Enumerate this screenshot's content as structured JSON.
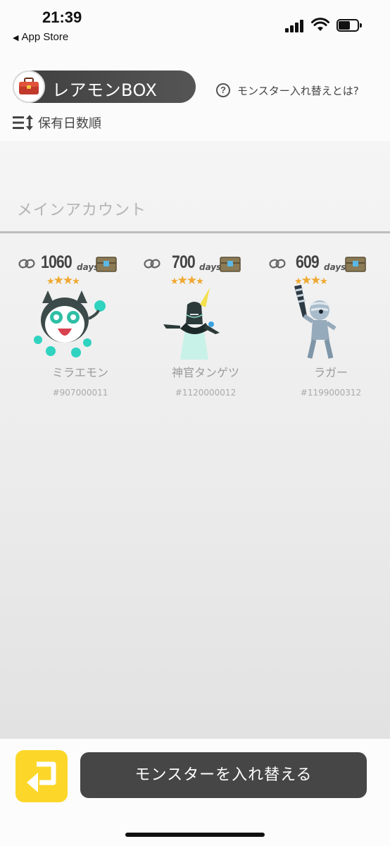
{
  "status_bar": {
    "time": "21:39",
    "back_label": "App Store"
  },
  "header": {
    "title": "レアモンBOX",
    "help_label": "モンスター入れ替えとは?",
    "sort_label": "保有日数順"
  },
  "section": {
    "title": "メインアカウント"
  },
  "monsters": [
    {
      "days": "1060",
      "days_unit": "days",
      "stars": 3,
      "name": "ミラエモン",
      "id": "#907000011"
    },
    {
      "days": "700",
      "days_unit": "days",
      "stars": 3,
      "name": "神官タンゲツ",
      "id": "#1120000012"
    },
    {
      "days": "609",
      "days_unit": "days",
      "stars": 3,
      "name": "ラガー",
      "id": "#1199000312"
    }
  ],
  "footer": {
    "swap_label": "モンスターを入れ替える"
  },
  "colors": {
    "accent_yellow": "#fcd72a",
    "button_dark": "#464646",
    "star": "#f0a830"
  },
  "icons": [
    "toolbox-icon",
    "help-icon",
    "sort-icon",
    "link-icon",
    "chest-icon",
    "exit-icon"
  ]
}
